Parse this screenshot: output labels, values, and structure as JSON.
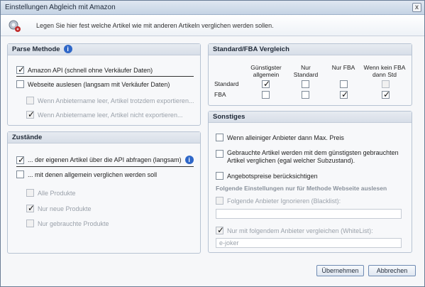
{
  "window": {
    "title": "Einstellungen Abgleich mit Amazon",
    "close_label": "x"
  },
  "header": {
    "text": "Legen Sie hier fest welche Artikel wie mit anderen Artikeln verglichen werden sollen."
  },
  "parse": {
    "title": "Parse Methode",
    "info_label": "i",
    "amazon_api": "Amazon API (schnell ohne Verkäufer Daten)",
    "webseite": "Webseite auslesen (langsam mit Verkäufer Daten)",
    "sub1": "Wenn Anbietername leer, Artikel trotzdem exportieren...",
    "sub2": "Wenn Anbietername leer, Artikel nicht exportieren..."
  },
  "zustaende": {
    "title": "Zustände",
    "info_label": "i",
    "eigene": "... der eigenen Artikel über die API abfragen (langsam)",
    "allgemein": "... mit denen allgemein verglichen werden soll",
    "alle": "Alle Produkte",
    "neu": "Nur neue Produkte",
    "gebraucht": "Nur gebrauchte Produkte"
  },
  "standard": {
    "title": "Standard/FBA Vergleich",
    "col1": "Günstigster allgemein",
    "col2": "Nur Standard",
    "col3": "Nur FBA",
    "col4": "Wenn kein FBA dann Std",
    "row1": "Standard",
    "row2": "FBA"
  },
  "sonstiges": {
    "title": "Sonstiges",
    "max_preis": "Wenn alleiniger Anbieter dann Max. Preis",
    "gebrauchte_line1": "Gebrauchte Artikel werden mit dem günstigsten gebrauchten",
    "gebrauchte_line2": "Artikel verglichen (egal welcher Subzustand).",
    "angebot": "Angebotspreise berücksichtigen",
    "webseite_heading": "Folgende Einstellungen nur für Methode Webseite auslesen",
    "blacklist": "Folgende Anbieter Ignorieren (Blacklist):",
    "blacklist_value": "",
    "whitelist": "Nur mit folgendem Anbieter vergleichen (WhiteList):",
    "whitelist_value": "e-joker"
  },
  "buttons": {
    "ok": "Übernehmen",
    "cancel": "Abbrechen"
  }
}
